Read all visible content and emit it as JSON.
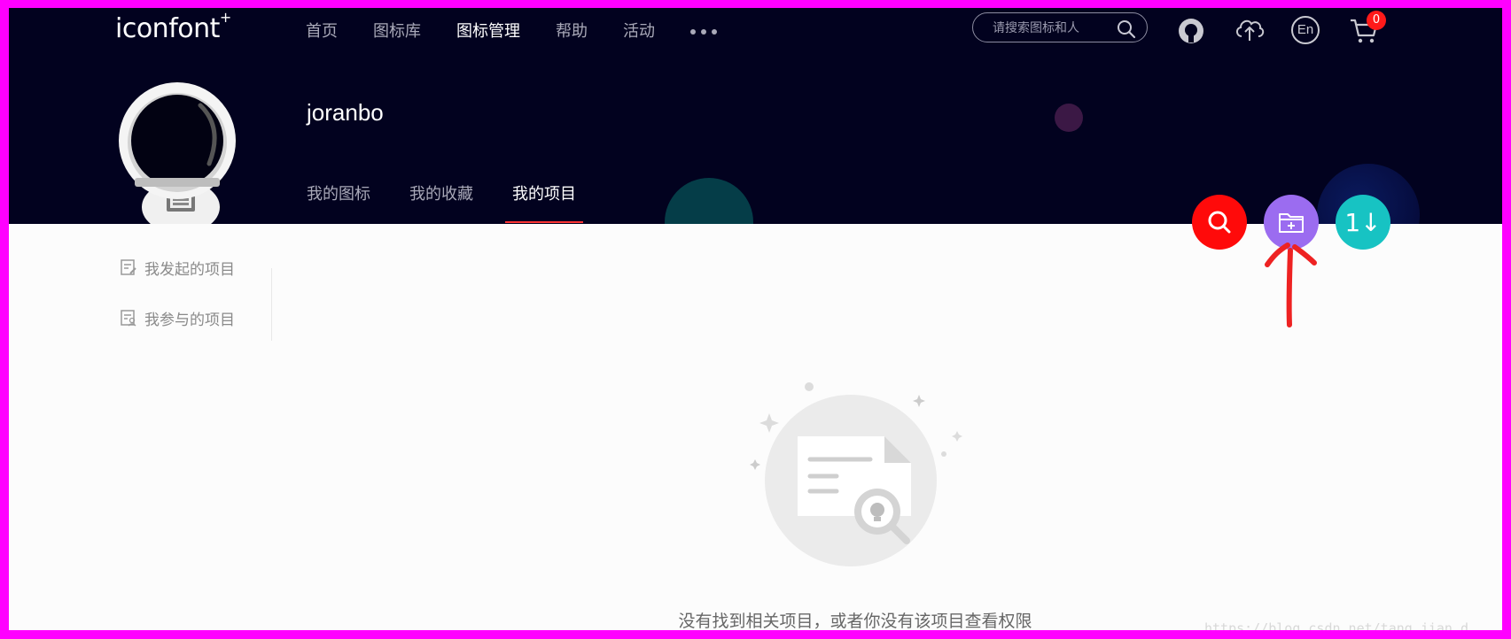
{
  "header": {
    "logo": "iconfont",
    "logo_plus": "+",
    "nav": [
      {
        "label": "首页",
        "active": false
      },
      {
        "label": "图标库",
        "active": false
      },
      {
        "label": "图标管理",
        "active": true
      },
      {
        "label": "帮助",
        "active": false
      },
      {
        "label": "活动",
        "active": false
      }
    ],
    "search_placeholder": "请搜索图标和人",
    "cart_count": "0",
    "lang_label": "En"
  },
  "profile": {
    "username": "joranbo",
    "tabs": [
      {
        "label": "我的图标",
        "active": false
      },
      {
        "label": "我的收藏",
        "active": false
      },
      {
        "label": "我的项目",
        "active": true
      }
    ]
  },
  "actions": {
    "search_color": "#ff0a0a",
    "new_project_color": "#9b6cf0",
    "sort_color": "#17c3c3",
    "sort_label": "1↓"
  },
  "sidebar": {
    "items": [
      {
        "label": "我发起的项目",
        "icon": "doc-edit-icon"
      },
      {
        "label": "我参与的项目",
        "icon": "doc-user-icon"
      }
    ]
  },
  "empty_state": {
    "message": "没有找到相关项目，或者你没有该项目查看权限"
  },
  "watermark": "https://blog.csdn.net/tang_jian_d"
}
